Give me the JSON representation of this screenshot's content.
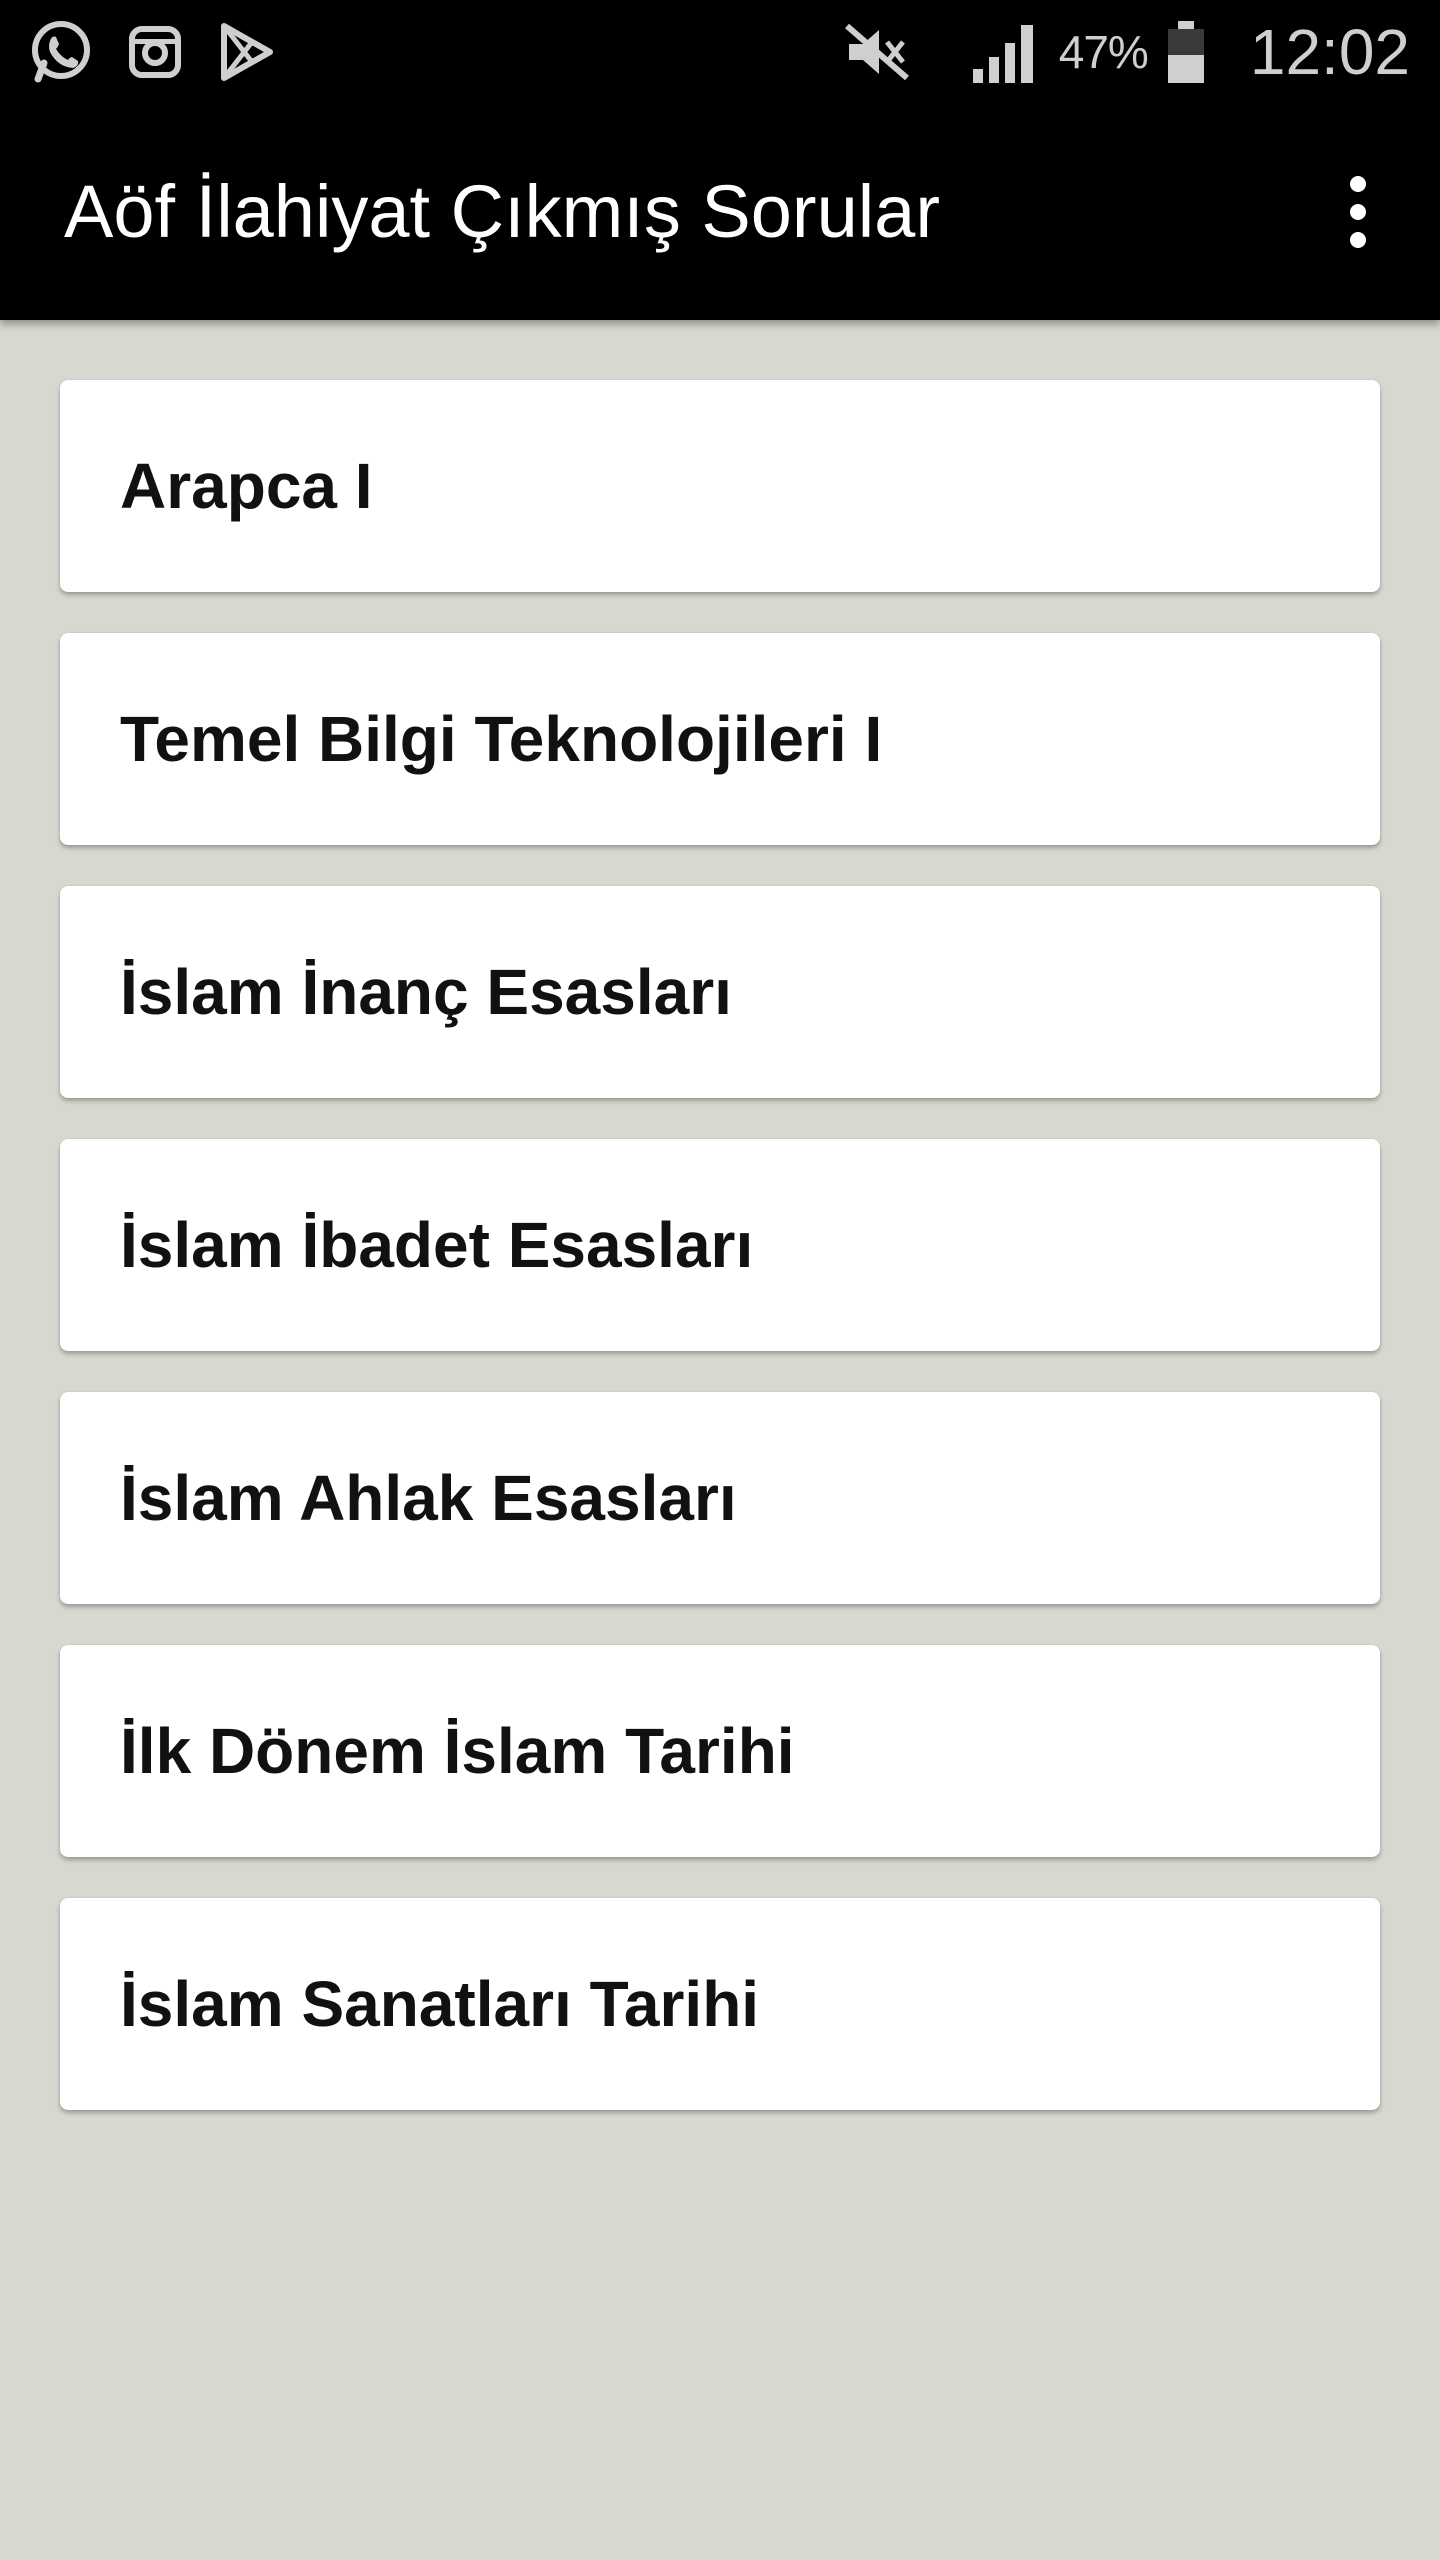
{
  "status_bar": {
    "notification_icons": [
      "whatsapp-icon",
      "instagram-icon",
      "play-store-icon"
    ],
    "system_icons": [
      "mute-icon",
      "signal-icon",
      "battery-icon"
    ],
    "battery_percent": "47%",
    "time": "12:02"
  },
  "app_bar": {
    "title": "Aöf İlahiyat Çıkmış Sorular",
    "menu_icon": "overflow-menu-icon"
  },
  "courses": [
    {
      "label": "Arapca I"
    },
    {
      "label": "Temel Bilgi Teknolojileri I"
    },
    {
      "label": "İslam İnanç Esasları"
    },
    {
      "label": "İslam İbadet Esasları"
    },
    {
      "label": "İslam Ahlak Esasları"
    },
    {
      "label": "İlk Dönem İslam Tarihi"
    },
    {
      "label": "İslam Sanatları Tarihi"
    }
  ],
  "colors": {
    "app_bar": "#000000",
    "background": "#d8d8d0",
    "card": "#ffffff",
    "text": "#111111"
  }
}
